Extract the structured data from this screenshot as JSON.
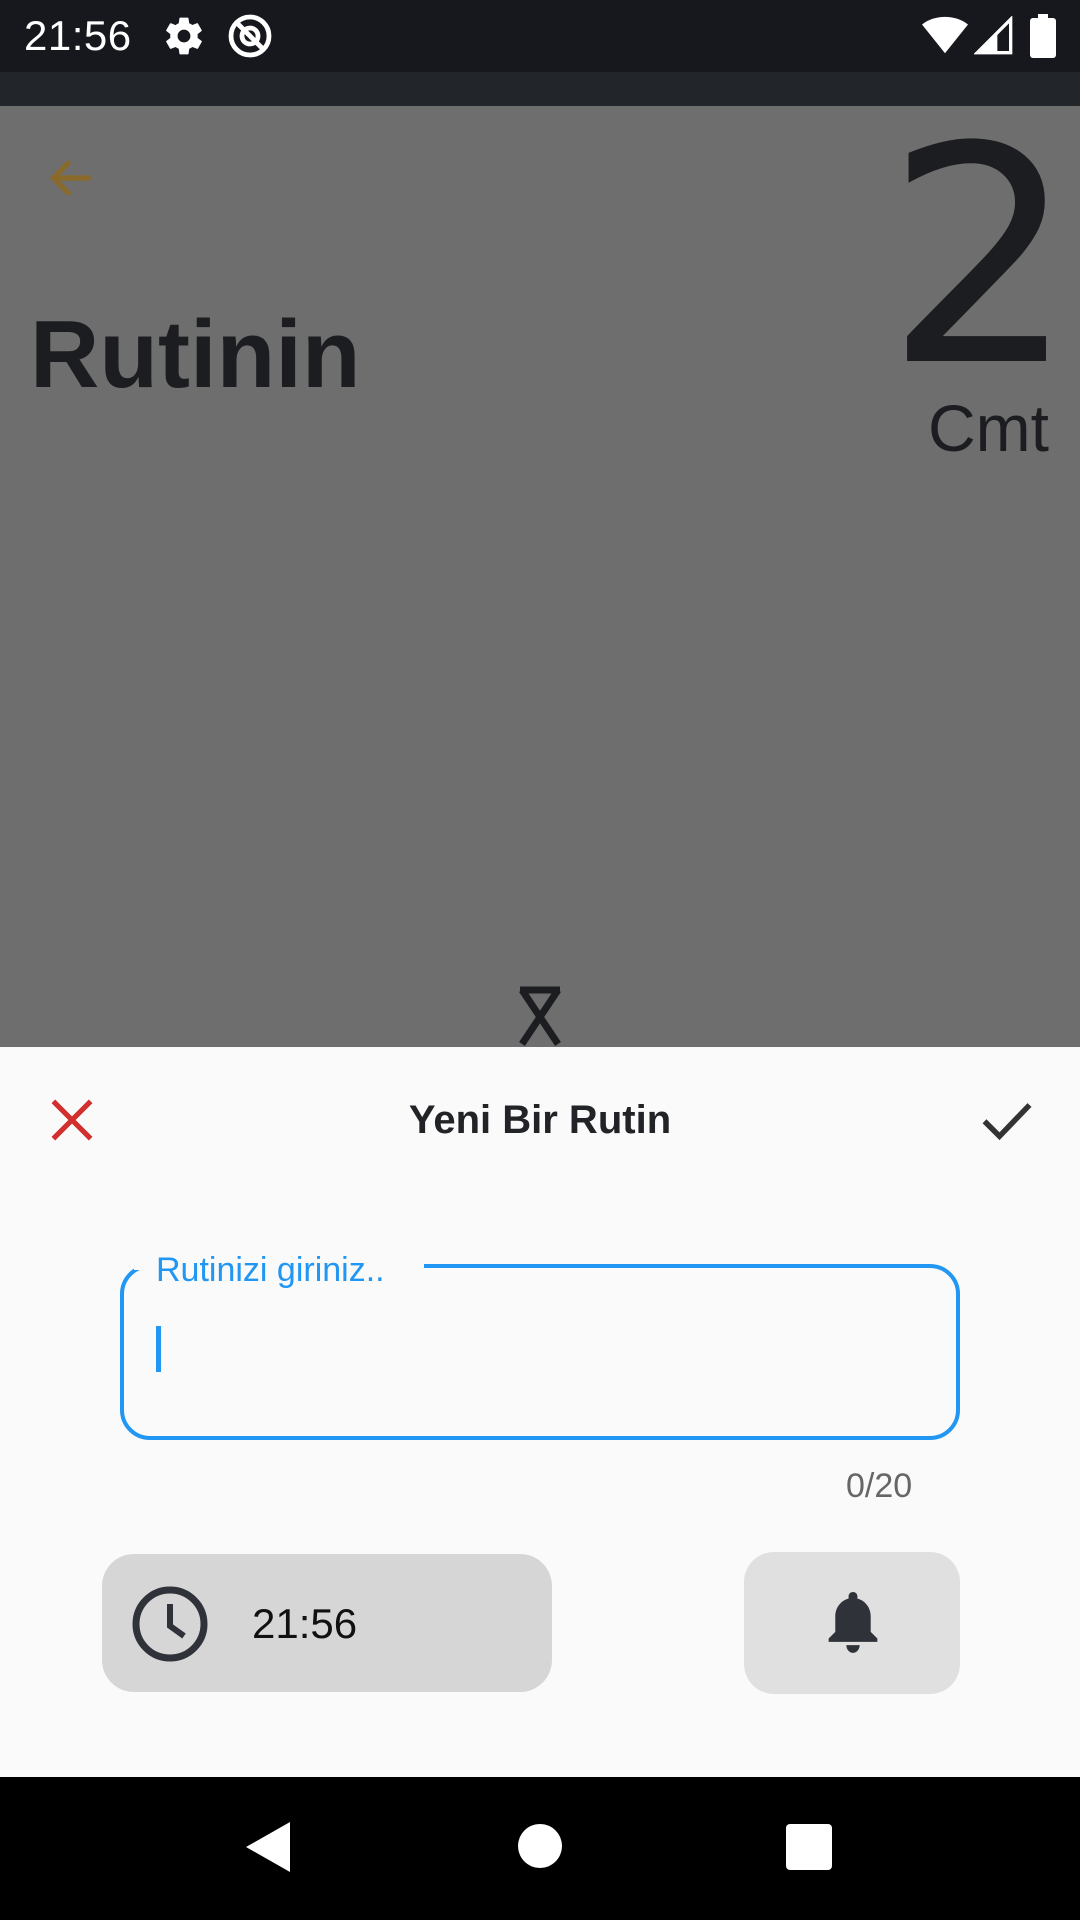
{
  "status_bar": {
    "time": "21:56",
    "icons": [
      "gear-icon",
      "at-sign-icon",
      "wifi-icon",
      "cell-signal-icon",
      "battery-icon"
    ]
  },
  "background": {
    "heading": "Rutinin",
    "count": "2",
    "count_unit": "Cmt",
    "back_icon": "arrow-left-icon",
    "hourglass_icon": "hourglass-icon"
  },
  "sheet": {
    "title": "Yeni Bir Rutin",
    "close_icon": "close-icon",
    "confirm_icon": "check-icon",
    "input": {
      "label": "Rutinizi giriniz..",
      "value": "",
      "counter": "0/20"
    },
    "time_button": {
      "icon": "clock-icon",
      "label": "21:56"
    },
    "bell_button": {
      "icon": "bell-icon"
    }
  },
  "nav_bar": {
    "icons": [
      "back-triangle-icon",
      "home-circle-icon",
      "recents-square-icon"
    ]
  },
  "colors": {
    "accent": "#2196f3",
    "close": "#d32f2f",
    "back_arrow": "#8a6a2a",
    "sheet_bg": "#fafafa",
    "scrim": "#6e6e6e"
  }
}
